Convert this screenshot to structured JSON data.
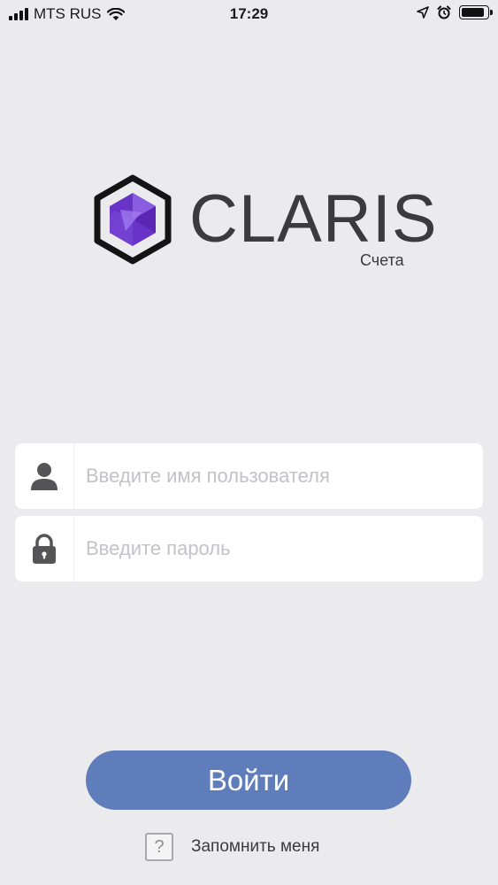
{
  "status_bar": {
    "carrier": "MTS RUS",
    "time": "17:29",
    "icons": [
      "signal-icon",
      "wifi-icon",
      "location-arrow-icon",
      "alarm-icon",
      "battery-icon"
    ],
    "battery_level": 0.9
  },
  "logo": {
    "name": "CLARIS",
    "subtitle": "Счета"
  },
  "form": {
    "username": {
      "icon": "user-icon",
      "value": "",
      "placeholder": "Введите имя пользователя"
    },
    "password": {
      "icon": "lock-icon",
      "value": "",
      "placeholder": "Введите пароль"
    },
    "login_label": "Войти",
    "remember": {
      "icon": "question-mark-icon",
      "glyph": "?",
      "label": "Запомнить меня"
    }
  },
  "colors": {
    "background": "#ebebed",
    "button": "#5e7dba",
    "logo_primary": "#7a3fd0",
    "logo_text": "#3b3b3d"
  }
}
